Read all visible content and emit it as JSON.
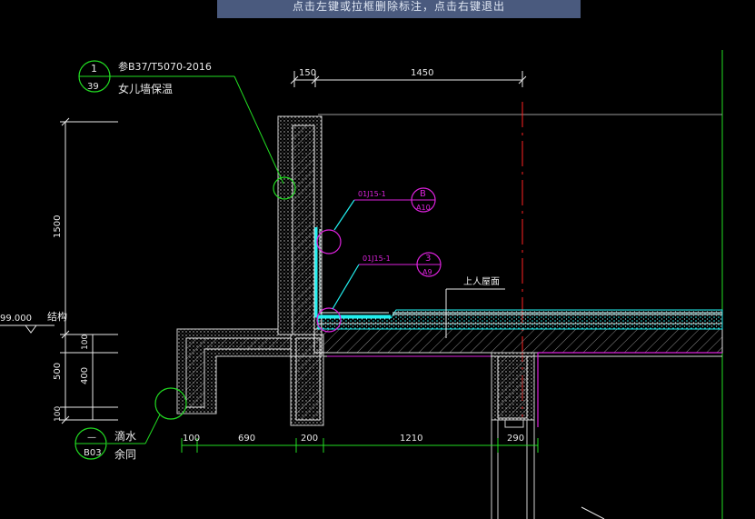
{
  "prompt": {
    "text": "点击左键或拉框删除标注，点击右键退出"
  },
  "callouts": {
    "top_left": {
      "num": "1",
      "sheet": "39",
      "ref": "参B37/T5070-2016",
      "title": "女儿墙保温"
    },
    "bottom_left": {
      "num": "—",
      "sheet": "B03",
      "title1": "滴水",
      "title2": "余同"
    },
    "detail_b": {
      "ref": "01J15-1",
      "num": "B",
      "sheet": "A10"
    },
    "detail_3": {
      "ref": "01J15-1",
      "num": "3",
      "sheet": "A9"
    }
  },
  "labels": {
    "roof": "上人屋面",
    "elev": "99.000",
    "structure": "结构"
  },
  "dims": {
    "top_1": "150",
    "top_2": "1450",
    "left_1500": "1500",
    "left_100a": "100",
    "left_500": "500",
    "left_400": "400",
    "left_100b": "100",
    "bot_100": "100",
    "bot_690": "690",
    "bot_200": "200",
    "bot_1210": "1210",
    "bot_290": "290"
  },
  "colors": {
    "green": "#22dd22",
    "magenta": "#dd22dd",
    "cyan": "#22eeee",
    "red": "#ff2222",
    "white": "#e8e8e8",
    "gray": "#9a9a9a"
  }
}
